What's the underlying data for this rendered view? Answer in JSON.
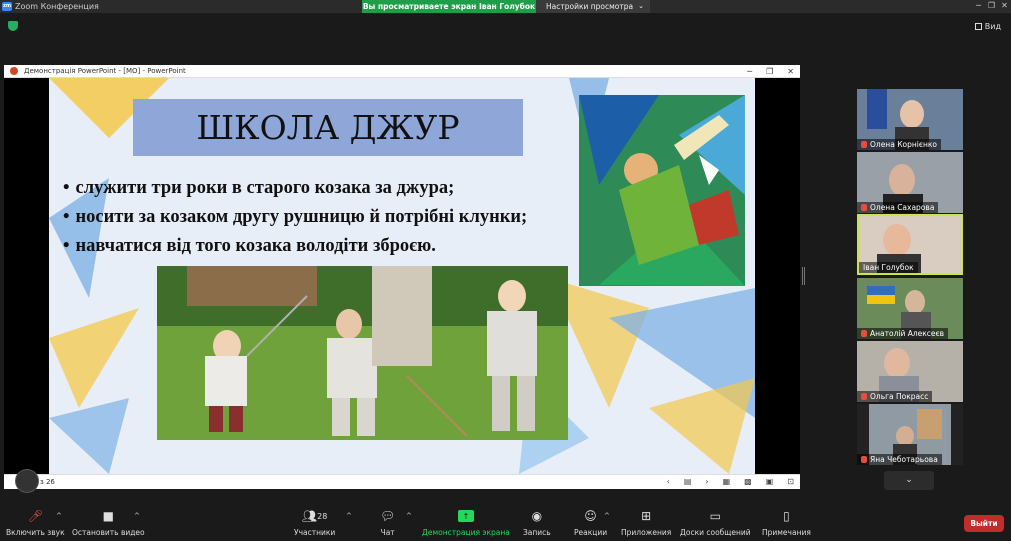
{
  "app": {
    "title": "Zoom Конференция",
    "logo": "zm",
    "sharing_banner": "Вы просматриваете экран Іван Голубок",
    "view_options": "Настройки просмотра",
    "view_button": "Вид"
  },
  "ppt": {
    "window_title": "Демонстрація PowerPoint - [МО] - PowerPoint",
    "page_count": "з 26",
    "slide": {
      "title": "ШКОЛА ДЖУР",
      "bullets": [
        "служити три роки в старого козака за джура;",
        "носити за козаком другу рушницю й потрібні клунки;",
        "навчатися від того козака володіти зброєю."
      ]
    }
  },
  "participants": [
    {
      "name": "Олена Корнієнко",
      "bg": "#6a7f9a",
      "muted": true
    },
    {
      "name": "Олена Сахарова",
      "bg": "#8a8f96",
      "muted": true
    },
    {
      "name": "Іван Голубок",
      "bg": "#c9b8a8",
      "muted": false,
      "speaking": true
    },
    {
      "name": "Анатолій Алексеєв",
      "bg": "#6b8c5a",
      "muted": true
    },
    {
      "name": "Ольга Покрасс",
      "bg": "#a5a09a",
      "muted": true
    },
    {
      "name": "Яна Чеботарьова",
      "bg": "#7f8b96",
      "muted": true
    }
  ],
  "more_participants": "⌄",
  "toolbar": {
    "mute": "Включить звук",
    "video": "Остановить видео",
    "participants": "Участники",
    "participants_count": "28",
    "chat": "Чат",
    "share": "Демонстрация экрана",
    "record": "Запись",
    "reactions": "Реакции",
    "apps": "Приложения",
    "whiteboard": "Доски сообщений",
    "notes": "Примечания",
    "leave": "Выйти"
  },
  "colors": {
    "share_green": "#1f9e49",
    "leave_red": "#c42b2b",
    "speaking_border": "#c6e64d"
  }
}
